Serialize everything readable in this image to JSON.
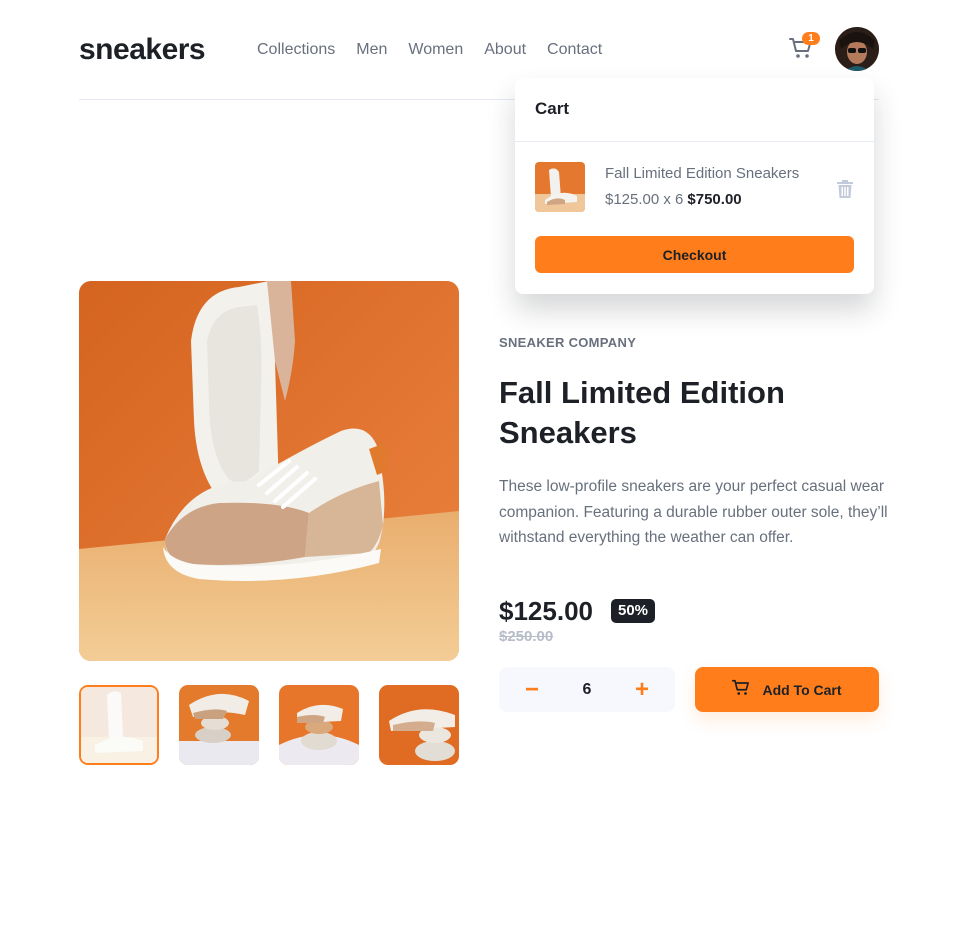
{
  "header": {
    "logo": "sneakers",
    "nav": [
      "Collections",
      "Men",
      "Women",
      "About",
      "Contact"
    ],
    "cart_icon": "cart-icon",
    "cart_count": "1"
  },
  "cart": {
    "title": "Cart",
    "item_name": "Fall Limited Edition Sneakers",
    "item_unit_price": "$125.00 x 6",
    "item_total": "$750.00",
    "delete_icon": "trash-icon",
    "checkout_label": "Checkout"
  },
  "gallery": {
    "thumbnail_count": 4,
    "active_index": 0
  },
  "product": {
    "company": "SNEAKER COMPANY",
    "title": "Fall Limited Edition Sneakers",
    "description": "These low-profile sneakers are your perfect casual wear companion. Featuring a durable rubber outer sole, they’ll withstand everything the weather can offer.",
    "price": "$125.00",
    "discount": "50%",
    "old_price": "$250.00",
    "quantity": "6",
    "minus": "−",
    "plus": "+",
    "add_to_cart_label": "Add To Cart"
  },
  "colors": {
    "accent": "#ff7e1b",
    "dark": "#1d2026",
    "muted": "#68707d",
    "light_bg": "#f6f8fd"
  }
}
